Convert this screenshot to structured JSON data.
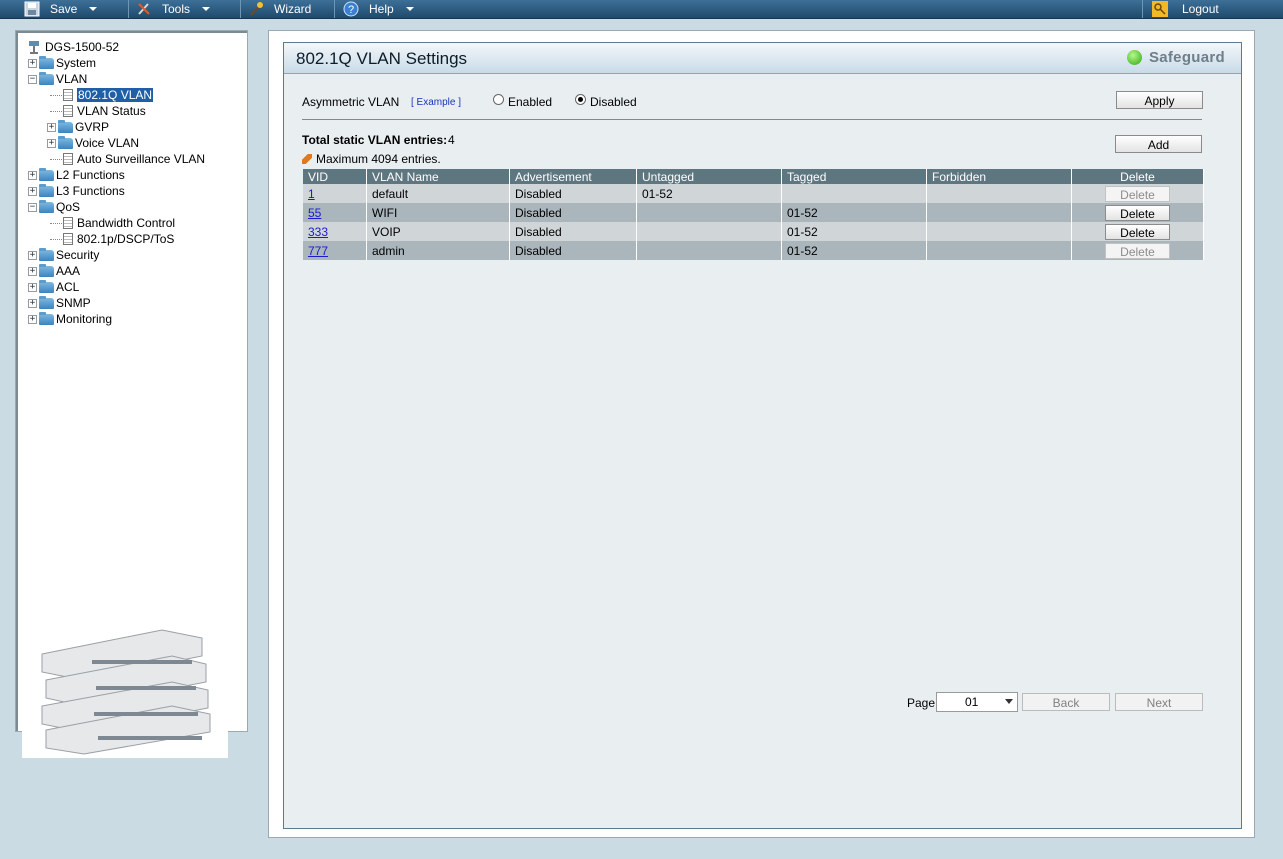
{
  "toolbar": {
    "save": "Save",
    "tools": "Tools",
    "wizard": "Wizard",
    "help": "Help",
    "logout": "Logout"
  },
  "tree": {
    "root": "DGS-1500-52",
    "system": "System",
    "vlan": "VLAN",
    "vlan_8021q": "802.1Q VLAN",
    "vlan_status": "VLAN Status",
    "gvrp": "GVRP",
    "voice_vlan": "Voice VLAN",
    "auto_surveillance": "Auto Surveillance VLAN",
    "l2": "L2 Functions",
    "l3": "L3 Functions",
    "qos": "QoS",
    "bandwidth": "Bandwidth Control",
    "dscp": "802.1p/DSCP/ToS",
    "security": "Security",
    "aaa": "AAA",
    "acl": "ACL",
    "snmp": "SNMP",
    "monitoring": "Monitoring"
  },
  "page": {
    "title": "802.1Q VLAN Settings",
    "safeguard": "Safeguard",
    "asym_label": "Asymmetric VLAN",
    "example_link": "[ Example ]",
    "enabled_label": "Enabled",
    "disabled_label": "Disabled",
    "asym_selected": "Disabled",
    "apply": "Apply",
    "total_label": "Total static VLAN entries:",
    "total_value": "4",
    "add": "Add",
    "max_note": "Maximum 4094 entries.",
    "page_label": "Page",
    "page_value": "01",
    "back": "Back",
    "next": "Next"
  },
  "table": {
    "headers": [
      "VID",
      "VLAN Name",
      "Advertisement",
      "Untagged",
      "Tagged",
      "Forbidden",
      "Delete"
    ],
    "rows": [
      {
        "vid": "1",
        "name": "default",
        "adv": "Disabled",
        "untagged": "01-52",
        "tagged": "",
        "forbidden": "",
        "delete": "Delete",
        "delete_enabled": false
      },
      {
        "vid": "55",
        "name": "WIFI",
        "adv": "Disabled",
        "untagged": "",
        "tagged": "01-52",
        "forbidden": "",
        "delete": "Delete",
        "delete_enabled": true
      },
      {
        "vid": "333",
        "name": "VOIP",
        "adv": "Disabled",
        "untagged": "",
        "tagged": "01-52",
        "forbidden": "",
        "delete": "Delete",
        "delete_enabled": true
      },
      {
        "vid": "777",
        "name": "admin",
        "adv": "Disabled",
        "untagged": "",
        "tagged": "01-52",
        "forbidden": "",
        "delete": "Delete",
        "delete_enabled": false
      }
    ]
  },
  "colors": {
    "toolbar": "#1f4a6d",
    "table_header": "#5e767f",
    "selected_tree": "#1f5fa8",
    "safeguard_ok": "#27a80f"
  }
}
